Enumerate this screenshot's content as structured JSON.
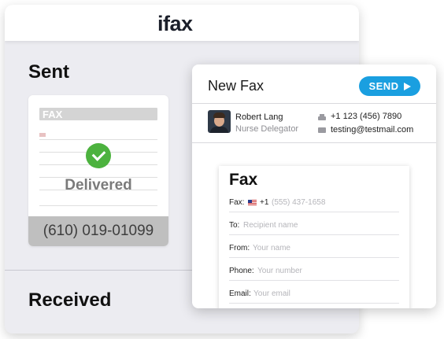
{
  "brand": {
    "logo_text": "ifax",
    "accent_color": "#1cc6d6"
  },
  "sent": {
    "title": "Sent",
    "status": "Delivered",
    "phone": "(610) 019-01099",
    "thumbnail_title": "FAX"
  },
  "received": {
    "title": "Received"
  },
  "new_fax": {
    "title": "New Fax",
    "send_label": "SEND",
    "sender": {
      "name": "Robert Lang",
      "role": "Nurse Delegator",
      "phone": "+1 123 (456) 7890",
      "email": "testing@testmail.com"
    },
    "form": {
      "title": "Fax",
      "fields": [
        {
          "label": "Fax:",
          "prefix": "+1",
          "placeholder": "(555) 437-1658"
        },
        {
          "label": "To:",
          "placeholder": "Recipient name"
        },
        {
          "label": "From:",
          "placeholder": "Your name"
        },
        {
          "label": "Phone:",
          "placeholder": "Your number"
        },
        {
          "label": "Email:",
          "placeholder": "Your email"
        }
      ]
    }
  },
  "colors": {
    "send_button": "#1a9fe0",
    "delivered_check": "#4cb23e",
    "panel_background": "#ececf1"
  }
}
